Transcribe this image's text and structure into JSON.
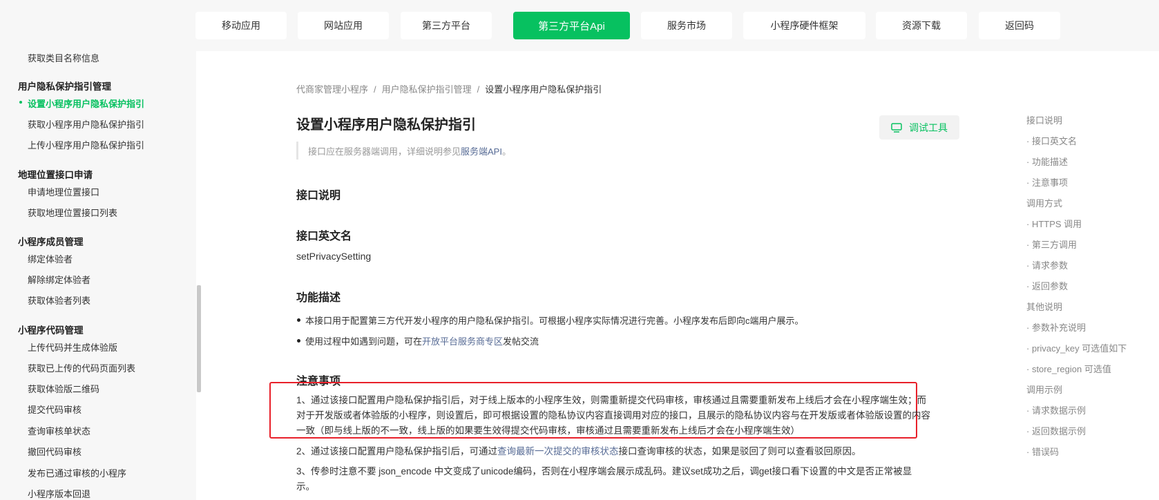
{
  "topnav": {
    "tabs": [
      {
        "label": "移动应用",
        "active": false
      },
      {
        "label": "网站应用",
        "active": false
      },
      {
        "label": "第三方平台",
        "active": false
      },
      {
        "label": "第三方平台Api",
        "active": true
      },
      {
        "label": "服务市场",
        "active": false
      },
      {
        "label": "小程序硬件框架",
        "active": false
      },
      {
        "label": "资源下载",
        "active": false
      },
      {
        "label": "返回码",
        "active": false
      }
    ]
  },
  "sidebar": {
    "top_item": "获取类目名称信息",
    "groups": [
      {
        "title": "用户隐私保护指引管理",
        "items": [
          "设置小程序用户隐私保护指引",
          "获取小程序用户隐私保护指引",
          "上传小程序用户隐私保护指引"
        ]
      },
      {
        "title": "地理位置接口申请",
        "items": [
          "申请地理位置接口",
          "获取地理位置接口列表"
        ]
      },
      {
        "title": "小程序成员管理",
        "items": [
          "绑定体验者",
          "解除绑定体验者",
          "获取体验者列表"
        ]
      },
      {
        "title": "小程序代码管理",
        "items": [
          "上传代码并生成体验版",
          "获取已上传的代码页面列表",
          "获取体验版二维码",
          "提交代码审核",
          "查询审核单状态",
          "撤回代码审核",
          "发布已通过审核的小程序",
          "小程序版本回退"
        ]
      }
    ]
  },
  "breadcrumb": [
    "代商家管理小程序",
    "用户隐私保护指引管理",
    "设置小程序用户隐私保护指引"
  ],
  "breadcrumb_sep": "/",
  "page_title": "设置小程序用户隐私保护指引",
  "debug_button": "调试工具",
  "note": {
    "text": "接口应在服务器端调用，详细说明参见",
    "link": "服务端API",
    "suffix": "。"
  },
  "sections": {
    "interface_desc": "接口说明",
    "english_name_title": "接口英文名",
    "english_name": "setPrivacySetting",
    "function_title": "功能描述",
    "function_bullets": [
      {
        "text": "本接口用于配置第三方代开发小程序的用户隐私保护指引。可根据小程序实际情况进行完善。小程序发布后即向c端用户展示。"
      },
      {
        "prefix": "使用过程中如遇到问题，可在",
        "link": "开放平台服务商专区",
        "suffix": "发帖交流"
      }
    ],
    "notice_title": "注意事项",
    "notice_1_line1": "1、通过该接口配置用户隐私保护指引后，对于线上版本的小程序生效，则需重新提交代码审核，审核通过且需要重新发布上线后才会在小程序端生效；而",
    "notice_1_line2": "对于开发版或者体验版的小程序，则设置后，即可根据设置的隐私协议内容直接调用对应的接口，且展示的隐私协议内容与在开发版或者体验版设置的内容",
    "notice_1_line3": "一致（即与线上版的不一致，线上版的如果要生效得提交代码审核，审核通过且需要重新发布上线后才会在小程序端生效）",
    "notice_2_prefix": "2、通过该接口配置用户隐私保护指引后，可通过",
    "notice_2_link": "查询最新一次提交的审核状态",
    "notice_2_suffix": "接口查询审核的状态，如果是驳回了则可以查看驳回原因。",
    "notice_3_line1": "3、传参时注意不要 json_encode 中文变成了unicode编码，否则在小程序端会展示成乱码。建议set成功之后，调get接口看下设置的中文是否正常被显",
    "notice_3_line2": "示。"
  },
  "toc": [
    "接口说明",
    "· 接口英文名",
    "· 功能描述",
    "· 注意事项",
    "调用方式",
    "· HTTPS 调用",
    "· 第三方调用",
    "· 请求参数",
    "· 返回参数",
    "其他说明",
    "· 参数补充说明",
    "· privacy_key 可选值如下",
    "· store_region 可选值",
    "调用示例",
    "· 请求数据示例",
    "· 返回数据示例",
    "· 错误码"
  ],
  "colors": {
    "accent": "#07c160",
    "link": "#576b95",
    "highlight": "#e8202a"
  }
}
